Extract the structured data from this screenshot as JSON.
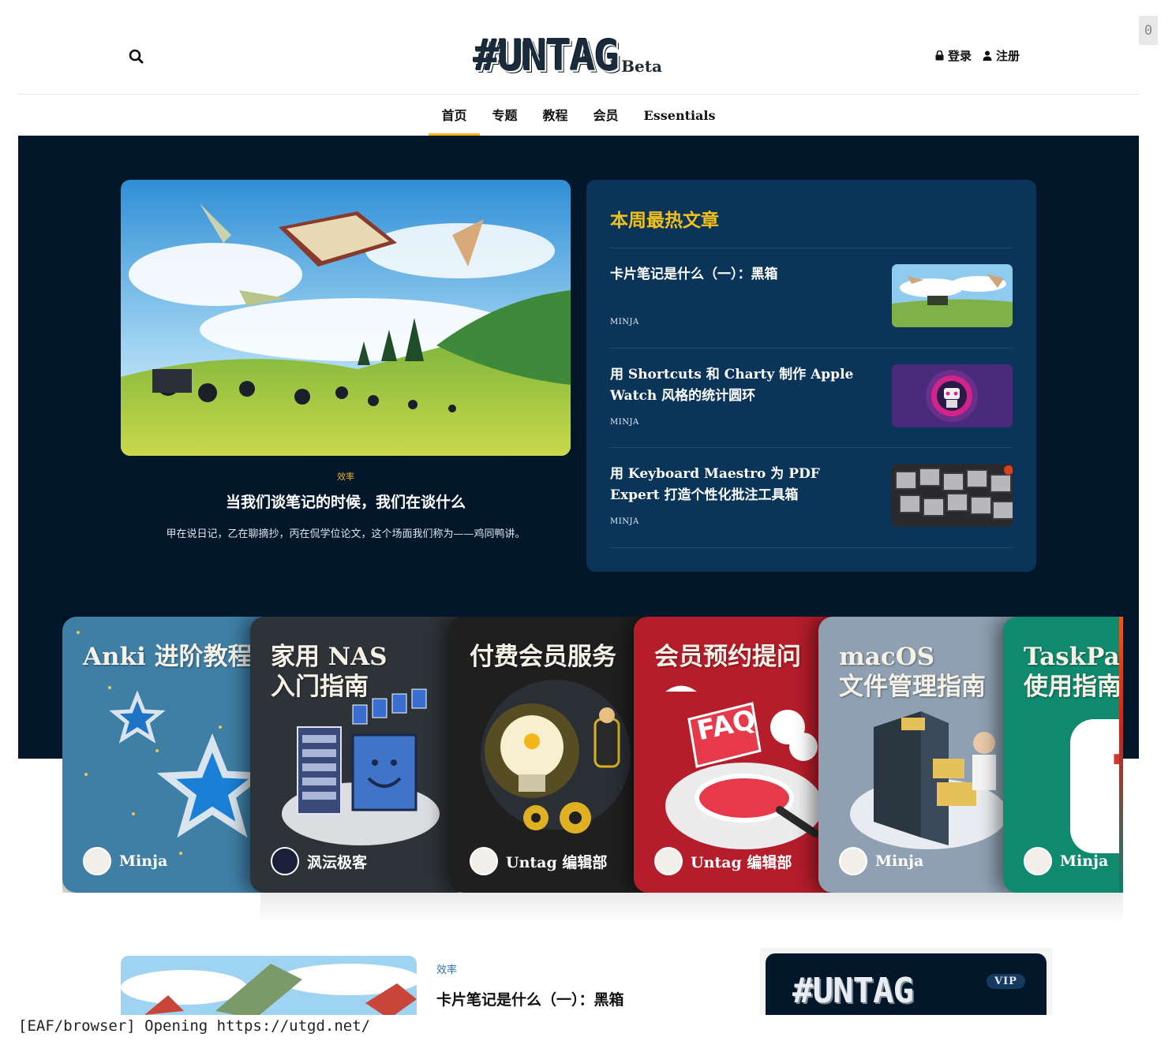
{
  "header": {
    "logo_text": "#UNTAG",
    "logo_suffix": "Beta",
    "login": "登录",
    "register": "注册",
    "corner_badge": "0"
  },
  "nav": {
    "items": [
      "首页",
      "专题",
      "教程",
      "会员",
      "Essentials"
    ],
    "active_index": 0
  },
  "featured": {
    "tag": "效率",
    "title": "当我们谈笔记的时候，我们在谈什么",
    "description": "甲在说日记，乙在聊摘抄，丙在侃学位论文，这个场面我们称为——鸡同鸭讲。"
  },
  "hot": {
    "title": "本周最热文章",
    "items": [
      {
        "title": "卡片笔记是什么（一）：黑箱",
        "author": "MINJA"
      },
      {
        "title": "用 Shortcuts 和 Charty 制作 Apple Watch 风格的统计圆环",
        "author": "MINJA"
      },
      {
        "title": "用 Keyboard Maestro 为 PDF Expert 打造个性化批注工具箱",
        "author": "MINJA"
      }
    ]
  },
  "cards": [
    {
      "title_line1": "Anki 进阶教程",
      "title_line2": "",
      "author": "Minja",
      "color": "#3f7fa6"
    },
    {
      "title_line1": "家用 NAS",
      "title_line2": "入门指南",
      "author": "沨沄极客",
      "color": "#2e3338"
    },
    {
      "title_line1": "付费会员服务",
      "title_line2": "",
      "author": "Untag 编辑部",
      "color": "#1f1f1f"
    },
    {
      "title_line1": "会员预约提问",
      "title_line2": "",
      "author": "Untag 编辑部",
      "color": "#b51d2a"
    },
    {
      "title_line1": "macOS",
      "title_line2": "文件管理指南",
      "author": "Minja",
      "color": "#8ea0b1"
    },
    {
      "title_line1": "TaskPa",
      "title_line2": "使用指南",
      "author": "Minja",
      "color": "#0f8a6e"
    }
  ],
  "latest": {
    "tag": "效率",
    "title": "卡片笔记是什么（一）：黑箱"
  },
  "vip": {
    "logo_text": "#UNTAG",
    "badge": "VIP"
  },
  "status_bar": {
    "text": "[EAF/browser] Opening https://utgd.net/"
  },
  "colors": {
    "hero_bg": "#03172a",
    "hot_box_bg": "#0a3558",
    "accent": "#f2b61a",
    "tag_blue": "#2f6db3"
  }
}
